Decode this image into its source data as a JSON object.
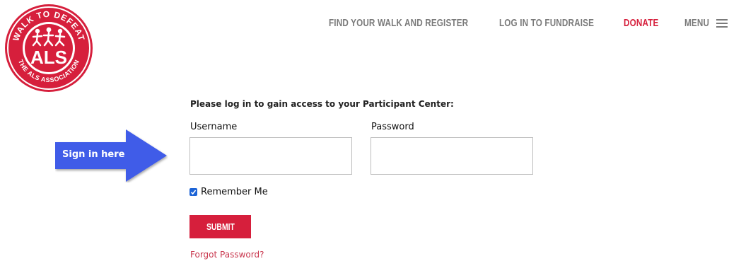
{
  "logo": {
    "top_text": "WALK TO DEFEAT",
    "center_text": "ALS",
    "bottom_text": "THE ALS ASSOCIATION",
    "brand_color": "#d61f3c"
  },
  "nav": {
    "items": [
      {
        "label": "FIND YOUR WALK AND REGISTER"
      },
      {
        "label": "LOG IN TO FUNDRAISE"
      },
      {
        "label": "DONATE"
      },
      {
        "label": "MENU"
      }
    ],
    "menu_icon": "hamburger-icon",
    "text_color": "#7a7a7a",
    "donate_color": "#d61f3c"
  },
  "login": {
    "instructions": "Please log in to gain access to your Participant Center:",
    "username_label": "Username",
    "username_value": "",
    "password_label": "Password",
    "password_value": "",
    "remember_label": "Remember Me",
    "remember_checked": true,
    "submit_label": "SUBMIT",
    "forgot_label": "Forgot Password?"
  },
  "callout": {
    "text": "Sign in here",
    "icon": "arrow-right-icon",
    "color": "#3f5be8"
  }
}
